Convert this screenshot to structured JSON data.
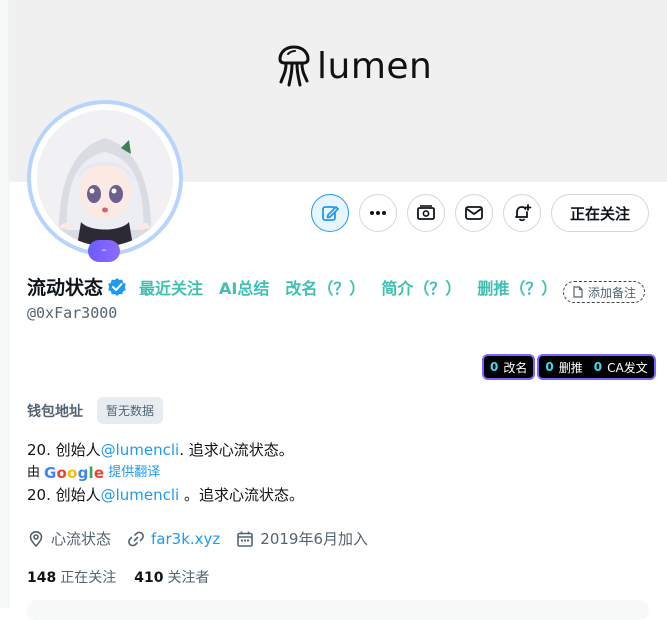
{
  "banner": {
    "logo_text": "lumen"
  },
  "avatar": {
    "badge_text": "–"
  },
  "actions": {
    "icons": [
      "edit-icon",
      "more-icon",
      "money-icon",
      "mail-icon",
      "notification-add-icon"
    ],
    "follow_label": "正在关注"
  },
  "profile": {
    "display_name": "流动状态",
    "handle": "@0xFar3000",
    "name_links": [
      "最近关注",
      "AI总结",
      "改名（？）",
      "简介（？）",
      "删推（？）"
    ],
    "add_note_label": "添加备注"
  },
  "stats_chips": [
    {
      "count": "0",
      "label": "改名"
    },
    {
      "count": "0",
      "label": "删推"
    },
    {
      "count": "0",
      "label": "CA发文"
    }
  ],
  "wallet": {
    "label": "钱包地址",
    "value": "暂无数据"
  },
  "bio": {
    "line1_prefix": "20. 创始人",
    "line1_mention": "@lumencli",
    "line1_suffix": ". 追求心流状态。",
    "translate_by": "由",
    "translate_brand": "Google",
    "translate_action": "提供翻译",
    "line2_prefix": "20. 创始人",
    "line2_mention": "@lumencli",
    "line2_suffix": " 。追求心流状态。"
  },
  "meta": {
    "location": "心流状态",
    "website": "far3k.xyz",
    "joined": "2019年6月加入"
  },
  "follow": {
    "following_count": "148",
    "following_label": "正在关注",
    "followers_count": "410",
    "followers_label": "关注者"
  },
  "colors": {
    "accent": "#1d9bf0",
    "name_link": "#40c0b0",
    "chip_count": "#3dd9f0",
    "chip_border": "#7b63ff",
    "avatar_ring": "#b7d4ff"
  }
}
